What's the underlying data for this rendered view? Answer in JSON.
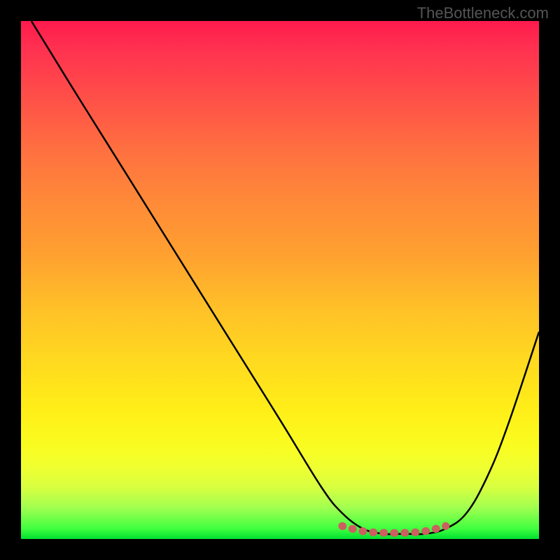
{
  "watermark": "TheBottleneck.com",
  "chart_data": {
    "type": "line",
    "title": "",
    "xlabel": "",
    "ylabel": "",
    "xlim": [
      0,
      100
    ],
    "ylim": [
      0,
      100
    ],
    "series": [
      {
        "name": "bottleneck-curve",
        "x": [
          2,
          10,
          20,
          30,
          40,
          50,
          58,
          62,
          66,
          70,
          74,
          78,
          82,
          86,
          90,
          94,
          100
        ],
        "y": [
          100,
          87,
          71,
          55,
          39,
          23,
          10,
          5,
          2,
          1,
          1,
          1,
          2,
          5,
          12,
          22,
          40
        ],
        "color": "#000000"
      },
      {
        "name": "optimal-band",
        "x": [
          62,
          66,
          70,
          74,
          78,
          82
        ],
        "y": [
          2.5,
          1.5,
          1.2,
          1.2,
          1.5,
          2.5
        ],
        "color": "#d06060"
      }
    ],
    "gradient_stops": [
      {
        "pos": 0,
        "color": "#ff1a4d"
      },
      {
        "pos": 50,
        "color": "#ffa030"
      },
      {
        "pos": 80,
        "color": "#fff020"
      },
      {
        "pos": 100,
        "color": "#00e030"
      }
    ]
  }
}
